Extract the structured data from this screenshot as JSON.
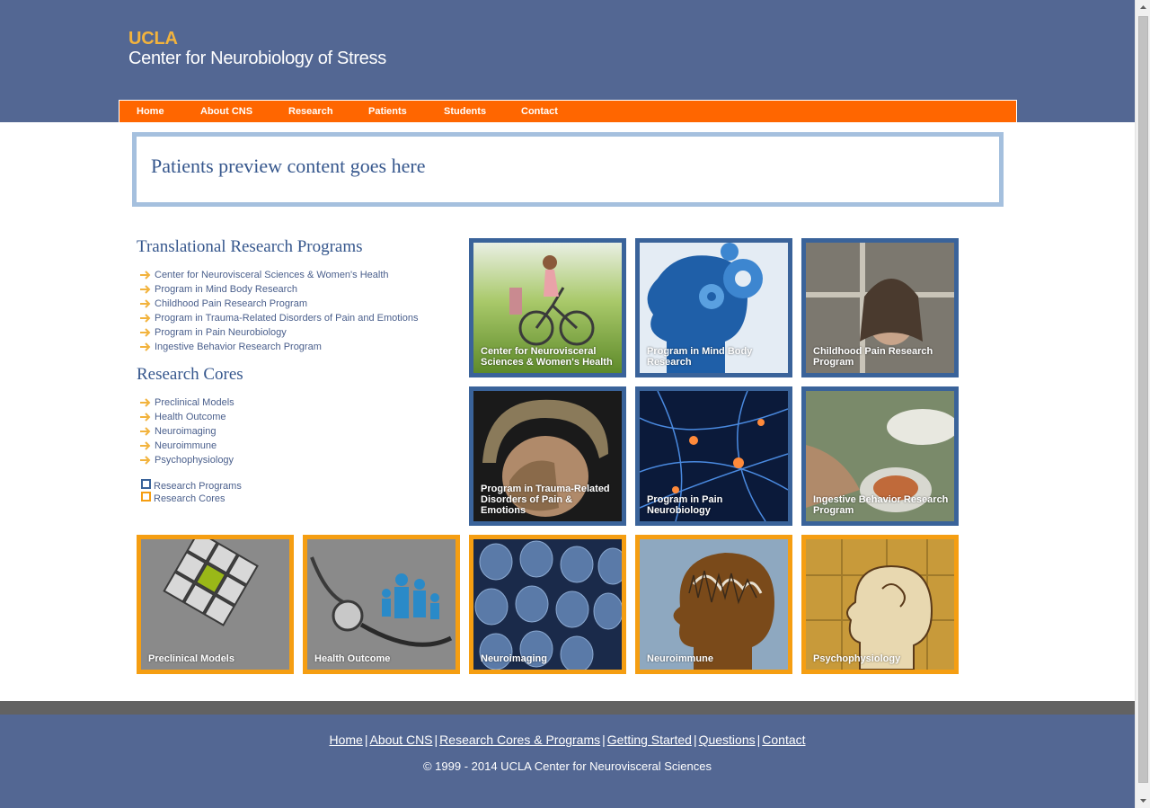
{
  "header": {
    "logo_top": "UCLA",
    "logo_bottom": "Center for Neurobiology of Stress"
  },
  "nav": {
    "items": [
      {
        "label": "Home"
      },
      {
        "label": "About CNS"
      },
      {
        "label": "Research"
      },
      {
        "label": "Patients"
      },
      {
        "label": "Students"
      },
      {
        "label": "Contact"
      }
    ]
  },
  "preview": {
    "text": "Patients preview content goes here"
  },
  "programs": {
    "title": "Translational Research Programs",
    "items": [
      {
        "label": "Center for Neurovisceral Sciences & Women's Health"
      },
      {
        "label": "Program in Mind Body Research"
      },
      {
        "label": "Childhood Pain Research Program"
      },
      {
        "label": "Program in Trauma-Related Disorders of Pain and Emotions"
      },
      {
        "label": "Program in Pain Neurobiology"
      },
      {
        "label": "Ingestive Behavior Research Program"
      }
    ]
  },
  "cores": {
    "title": "Research Cores",
    "items": [
      {
        "label": "Preclinical Models"
      },
      {
        "label": "Health Outcome"
      },
      {
        "label": "Neuroimaging"
      },
      {
        "label": "Neuroimmune"
      },
      {
        "label": "Psychophysiology"
      }
    ]
  },
  "legend": {
    "programs_label": "Research Programs",
    "programs_color": "#3a639a",
    "cores_label": "Research Cores",
    "cores_color": "#f59e12"
  },
  "tiles": {
    "program_tiles": [
      {
        "label": "Center for Neurovisceral Sciences & Women's Health",
        "icon": "woman-cycling-photo"
      },
      {
        "label": "Program in Mind Body Research",
        "icon": "head-gears-photo"
      },
      {
        "label": "Childhood Pain Research Program",
        "icon": "child-window-photo"
      },
      {
        "label": "Program in Trauma-Related Disorders of Pain & Emotions",
        "icon": "soldier-photo"
      },
      {
        "label": "Program in Pain Neurobiology",
        "icon": "neurons-photo"
      },
      {
        "label": "Ingestive Behavior Research Program",
        "icon": "dining-table-photo"
      }
    ],
    "core_tiles": [
      {
        "label": "Preclinical Models",
        "icon": "cube-grid-photo"
      },
      {
        "label": "Health Outcome",
        "icon": "stethoscope-family-photo"
      },
      {
        "label": "Neuroimaging",
        "icon": "brain-scans-photo"
      },
      {
        "label": "Neuroimmune",
        "icon": "head-profile-photo"
      },
      {
        "label": "Psychophysiology",
        "icon": "puzzle-head-photo"
      }
    ]
  },
  "footer": {
    "links": [
      {
        "label": "Home"
      },
      {
        "label": "About CNS"
      },
      {
        "label": "Research Cores & Programs"
      },
      {
        "label": "Getting Started"
      },
      {
        "label": "Questions"
      },
      {
        "label": "Contact"
      }
    ],
    "separator": "|",
    "copyright": "© 1999 - 2014 UCLA Center for Neurovisceral Sciences"
  },
  "colors": {
    "header_bg": "#536793",
    "nav_bg": "#ff6600",
    "accent_gold": "#f2b33d",
    "program_border": "#3a639a",
    "core_border": "#f59e12",
    "title_blue": "#36578d"
  }
}
